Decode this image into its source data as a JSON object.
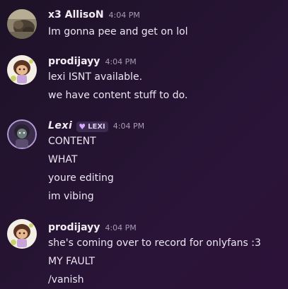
{
  "messages": [
    {
      "username": "x3 AllisoN",
      "timestamp": "4:04 PM",
      "lines": [
        "Im gonna pee and get on lol"
      ],
      "avatar_icon": "cat-photo-avatar"
    },
    {
      "username": "prodijayy",
      "timestamp": "4:04 PM",
      "lines": [
        "lexi ISNT available.",
        "we have content stuff to do."
      ],
      "avatar_icon": "character-avatar"
    },
    {
      "username": "Lexi",
      "role_tag": "LEXI",
      "timestamp": "4:04 PM",
      "lines": [
        "CONTENT",
        "WHAT",
        "youre editing",
        "im vibing"
      ],
      "avatar_icon": "character-avatar"
    },
    {
      "username": "prodijayy",
      "timestamp": "4:04 PM",
      "lines": [
        "she's coming over to record for onlyfans :3",
        "MY FAULT",
        "/vanish"
      ],
      "avatar_icon": "character-avatar"
    }
  ],
  "colors": {
    "background": "#241330",
    "username": "#f2edf5",
    "timestamp": "#a89cb3",
    "tag_background": "#3c2a50",
    "tag_heart": "#d6a8ff"
  }
}
